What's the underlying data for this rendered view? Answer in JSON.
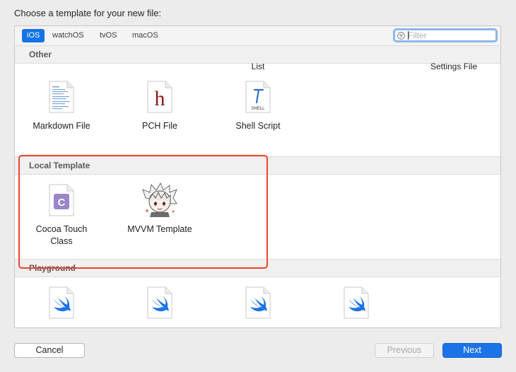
{
  "dialog": {
    "title": "Choose a template for your new file:"
  },
  "platforms": [
    {
      "label": "iOS",
      "active": true
    },
    {
      "label": "watchOS",
      "active": false
    },
    {
      "label": "tvOS",
      "active": false
    },
    {
      "label": "macOS",
      "active": false
    }
  ],
  "filter": {
    "placeholder": "Filter",
    "value": ""
  },
  "clipped_labels": [
    "List",
    "Settings File"
  ],
  "sections": {
    "other": {
      "header": "Other",
      "items": [
        {
          "label": "Markdown File",
          "icon": "markdown-file-icon"
        },
        {
          "label": "PCH File",
          "icon": "pch-file-icon",
          "glyph": "h"
        },
        {
          "label": "Shell Script",
          "icon": "shell-script-icon",
          "glyph": "SHELL"
        }
      ]
    },
    "local_template": {
      "header": "Local Template",
      "items": [
        {
          "label": "Cocoa Touch Class",
          "label_line1": "Cocoa Touch",
          "label_line2": "Class",
          "icon": "cocoa-touch-class-icon",
          "glyph": "C"
        },
        {
          "label": "MVVM Template",
          "icon": "mvvm-avatar-icon"
        }
      ]
    },
    "playground": {
      "header": "Playground",
      "items": [
        {
          "icon": "swift-file-icon"
        },
        {
          "icon": "swift-file-icon"
        },
        {
          "icon": "swift-file-icon"
        },
        {
          "icon": "swift-file-icon"
        }
      ]
    }
  },
  "buttons": {
    "cancel": "Cancel",
    "previous": "Previous",
    "next": "Next"
  },
  "colors": {
    "accent": "#1473e6",
    "highlight_border": "#e8452d",
    "pch_glyph": "#8b1a1a",
    "swift": "#1b73e8",
    "cocoa_purple": "#9a86c8"
  }
}
